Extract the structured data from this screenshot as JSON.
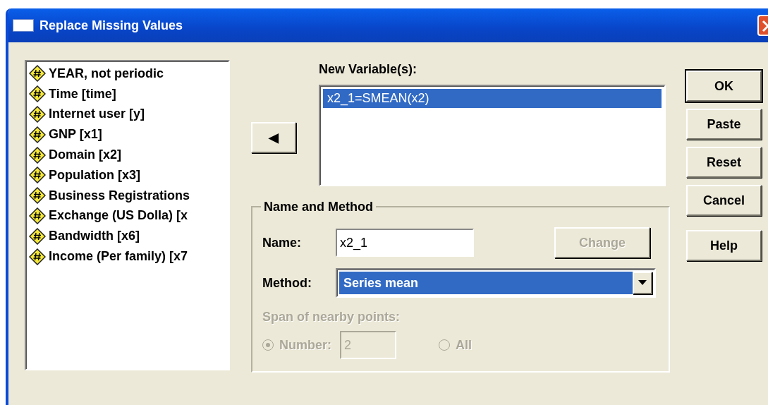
{
  "window": {
    "title": "Replace Missing Values"
  },
  "variables": [
    {
      "label": "YEAR, not periodic"
    },
    {
      "label": "Time [time]"
    },
    {
      "label": "Internet user [y]"
    },
    {
      "label": "GNP [x1]"
    },
    {
      "label": "Domain [x2]"
    },
    {
      "label": "Population [x3]"
    },
    {
      "label": "Business Registrations"
    },
    {
      "label": "Exchange (US Dolla) [x"
    },
    {
      "label": "Bandwidth [x6]"
    },
    {
      "label": "Income (Per family) [x7"
    }
  ],
  "move_button": {
    "symbol": "◀"
  },
  "new_variables": {
    "label": "New Variable(s):",
    "items": [
      {
        "label": "x2_1=SMEAN(x2)",
        "selected": true
      }
    ]
  },
  "name_and_method": {
    "title": "Name and Method",
    "name_label": "Name:",
    "name_value": "x2_1",
    "change_button": {
      "label": "Change",
      "disabled": true
    },
    "method_label": "Method:",
    "method_value": "Series mean",
    "span_label": "Span of nearby points:",
    "span_disabled": true,
    "span_options": [
      {
        "label": "Number:",
        "selected": true,
        "kind": "number",
        "value": "2"
      },
      {
        "label": "All",
        "selected": false,
        "kind": "plain"
      }
    ]
  },
  "buttons": [
    {
      "label": "OK",
      "default": true
    },
    {
      "label": "Paste",
      "default": false
    },
    {
      "label": "Reset",
      "default": false
    },
    {
      "label": "Cancel",
      "default": false
    },
    {
      "label": "Help",
      "default": false
    }
  ]
}
